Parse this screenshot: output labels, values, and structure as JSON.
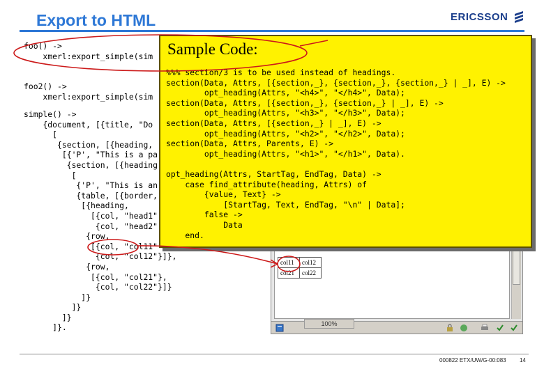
{
  "slide": {
    "title": "Export to HTML",
    "logo_text": "ERICSSON",
    "footer_doc": "000822 ETX/UW/G-00:083",
    "page_number": "14"
  },
  "code": {
    "foo": "foo() ->\n    xmerl:export_simple(sim",
    "foo2": "foo2() ->\n    xmerl:export_simple(sim",
    "simple_lines": [
      "simple() ->",
      "    {document, [{title, \"Do",
      "      [",
      "       {section, [{heading,",
      "        [{'P', \"This is a pa",
      "         {section, [{heading",
      "          [",
      "           {'P', \"This is an",
      "           {table, [{border,",
      "            [{heading,",
      "              [{col, \"head1\"",
      "               {col, \"head2\"",
      "             {row,",
      "              [{col, \"col11\"",
      "               {col, \"col12\"}]},",
      "             {row,",
      "              [{col, \"col21\"},",
      "               {col, \"col22\"}]}",
      "            ]}",
      "          ]}",
      "        ]}",
      "      ]}."
    ]
  },
  "callout": {
    "title": "Sample Code:",
    "code": "%%% section/3 is to be used instead of headings.\nsection(Data, Attrs, [{section,_}, {section,_}, {section,_} | _], E) ->\n        opt_heading(Attrs, \"<h4>\", \"</h4>\", Data);\nsection(Data, Attrs, [{section,_}, {section,_} | _], E) ->\n        opt_heading(Attrs, \"<h3>\", \"</h3>\", Data);\nsection(Data, Attrs, [{section,_} | _], E) ->\n        opt_heading(Attrs, \"<h2>\", \"</h2>\", Data);\nsection(Data, Attrs, Parents, E) ->\n        opt_heading(Attrs, \"<h1>\", \"</h1>\", Data).\n\nopt_heading(Attrs, StartTag, EndTag, Data) ->\n    case find_attribute(heading, Attrs) of\n        {value, Text} ->\n            [StartTag, Text, EndTag, \"\\n\" | Data];\n        false ->\n            Data\n    end."
  },
  "browser": {
    "table": [
      [
        "col11",
        "col12"
      ],
      [
        "col21",
        "col22"
      ]
    ],
    "zoom": "100%"
  },
  "colors": {
    "title_blue": "#2e78d6",
    "callout_yellow": "#fff200",
    "annotation_red": "#cc1a1a",
    "logo_navy": "#1c3f8c"
  }
}
